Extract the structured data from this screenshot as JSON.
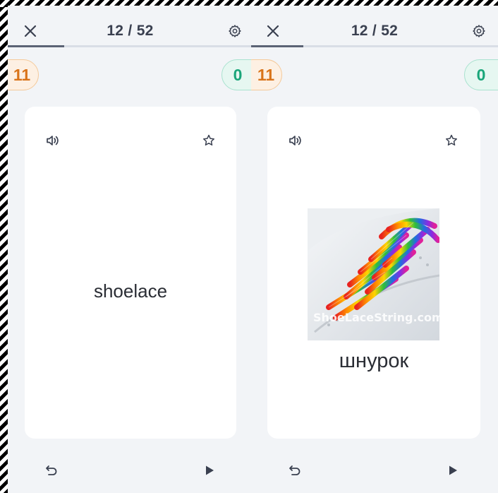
{
  "colors": {
    "panel_bg": "#f2f4f7",
    "text_dark": "#3a4050",
    "wrong_accent": "#d9741a",
    "correct_accent": "#1aa67a",
    "progress": "#5b6375"
  },
  "left_panel": {
    "header": {
      "close_icon": "close-icon",
      "counter": "12 / 52",
      "settings_icon": "gear-icon",
      "progress_fraction": 0.23
    },
    "score": {
      "wrong_count": "11",
      "correct_count": "0"
    },
    "card": {
      "audio_icon": "speaker-icon",
      "favorite_icon": "star-icon",
      "term": "shoelace"
    },
    "bottom": {
      "undo_icon": "undo-icon",
      "play_icon": "play-icon"
    }
  },
  "right_panel": {
    "header": {
      "close_icon": "close-icon",
      "counter": "12 / 52",
      "settings_icon": "gear-icon",
      "progress_fraction": 0.21
    },
    "score": {
      "wrong_count": "11",
      "correct_count": "0"
    },
    "card": {
      "audio_icon": "speaker-icon",
      "favorite_icon": "star-icon",
      "image_watermark": "ShoeLaceString.com",
      "definition": "шнурок"
    },
    "bottom": {
      "undo_icon": "undo-icon",
      "play_icon": "play-icon"
    }
  }
}
